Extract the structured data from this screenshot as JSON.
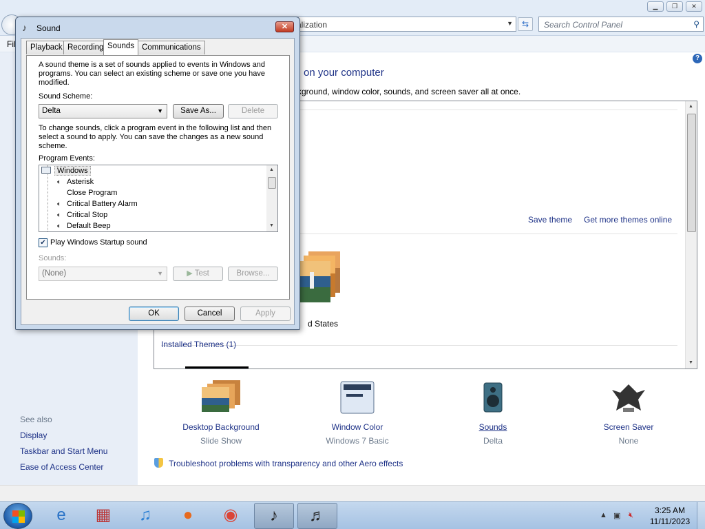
{
  "control_panel": {
    "address_text": "alization",
    "search_placeholder": "Search Control Panel",
    "menu_file": "Fil",
    "main_title": "on your computer",
    "main_desc": "ckground, window color, sounds, and screen saver all at once.",
    "save_theme": "Save theme",
    "get_more_themes": "Get more themes online",
    "theme_name": "d States",
    "installed_themes": "Installed Themes (1)",
    "see_also": "See also",
    "see_also_links": [
      "Display",
      "Taskbar and Start Menu",
      "Ease of Access Center"
    ],
    "bottom_items": [
      {
        "label": "Desktop Background",
        "sub": "Slide Show"
      },
      {
        "label": "Window Color",
        "sub": "Windows 7 Basic"
      },
      {
        "label": "Sounds",
        "sub": "Delta"
      },
      {
        "label": "Screen Saver",
        "sub": "None"
      }
    ],
    "troubleshoot": "Troubleshoot problems with transparency and other Aero effects",
    "help_glyph": "?",
    "window_buttons": {
      "minimize": "▁",
      "maximize": "❐",
      "close": "✕"
    }
  },
  "sound_dialog": {
    "title": "Sound",
    "close_glyph": "✕",
    "tabs": [
      "Playback",
      "Recording",
      "Sounds",
      "Communications"
    ],
    "active_tab": "Sounds",
    "intro": "A sound theme is a set of sounds applied to events in Windows and programs.  You can select an existing scheme or save one you have modified.",
    "scheme_label": "Sound Scheme:",
    "scheme_value": "Delta",
    "save_as": "Save As...",
    "delete": "Delete",
    "change_text": "To change sounds, click a program event in the following list and then select a sound to apply.  You can save the changes as a new sound scheme.",
    "events_label": "Program Events:",
    "events": [
      {
        "label": "Windows",
        "has_sound": false,
        "group": true
      },
      {
        "label": "Asterisk",
        "has_sound": true,
        "group": false
      },
      {
        "label": "Close Program",
        "has_sound": false,
        "group": false
      },
      {
        "label": "Critical Battery Alarm",
        "has_sound": true,
        "group": false
      },
      {
        "label": "Critical Stop",
        "has_sound": true,
        "group": false
      },
      {
        "label": "Default Beep",
        "has_sound": true,
        "group": false
      }
    ],
    "startup_label": "Play Windows Startup sound",
    "startup_checked": true,
    "sounds_label": "Sounds:",
    "sounds_value": "(None)",
    "test": "Test",
    "browse": "Browse...",
    "ok": "OK",
    "cancel": "Cancel",
    "apply": "Apply"
  },
  "taskbar": {
    "time": "3:25 AM",
    "date": "11/11/2023",
    "items": [
      "internet-explorer-icon",
      "archive-icon",
      "itunes-icon",
      "firefox-icon",
      "chrome-icon",
      "sound-app-icon",
      "speaker-app-icon"
    ]
  }
}
